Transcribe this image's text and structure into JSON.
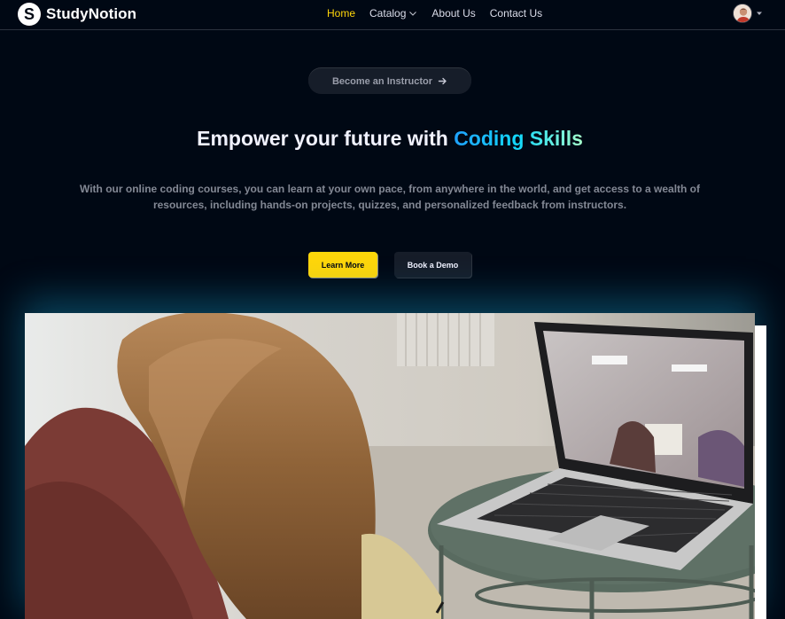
{
  "brand": {
    "name": "StudyNotion",
    "logo_letter": "S"
  },
  "nav": {
    "items": [
      {
        "label": "Home",
        "active": true
      },
      {
        "label": "Catalog",
        "dropdown": true
      },
      {
        "label": "About Us"
      },
      {
        "label": "Contact Us"
      }
    ]
  },
  "hero": {
    "instructor_button": "Become an Instructor",
    "title_prefix": "Empower your future with ",
    "title_highlight": "Coding Skills",
    "subtitle": "With our online coding courses, you can learn at your own pace, from anywhere in the world, and get access to a wealth of resources, including hands-on projects, quizzes, and personalized feedback from instructors.",
    "primary_button": "Learn More",
    "secondary_button": "Book a Demo"
  },
  "icons": {
    "dropdown": "chevron-down-icon",
    "instructor_arrow": "arrow-right-icon",
    "profile_caret": "caret-down-icon"
  },
  "colors": {
    "background": "#000814",
    "accent_yellow": "#ffd60a",
    "gradient_start": "#1fa2ff",
    "gradient_mid": "#12d8fa",
    "gradient_end": "#a6ffcb",
    "dark_button": "#161d29"
  }
}
